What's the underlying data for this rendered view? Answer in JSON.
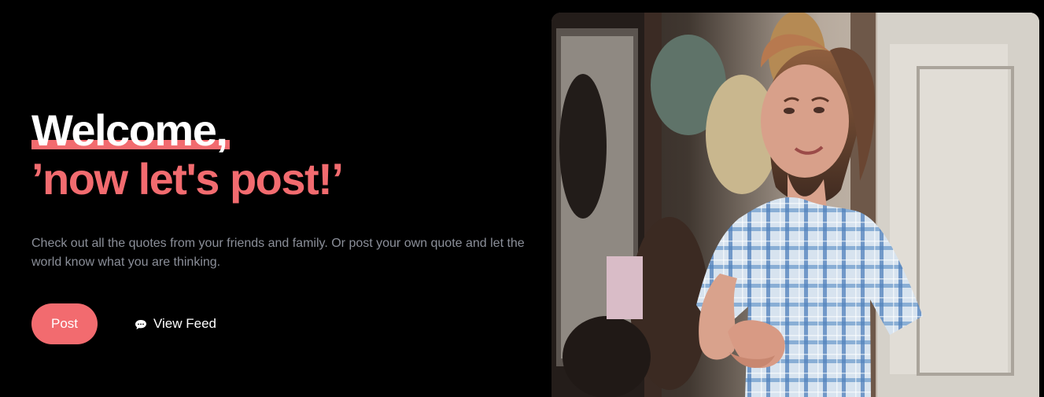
{
  "hero": {
    "title_line_1": "Welcome,",
    "title_line_2": "’now let's post!’",
    "description": "Check out all the quotes from your friends and family. Or post your own quote and let the world know what you are thinking."
  },
  "actions": {
    "post_label": "Post",
    "view_feed_label": "View Feed",
    "view_feed_icon": "chat-bubble-icon"
  },
  "image": {
    "subject": "woman in blue plaid top"
  },
  "colors": {
    "background": "#000000",
    "accent": "#f26b6f",
    "muted_text": "#8b8f99"
  }
}
